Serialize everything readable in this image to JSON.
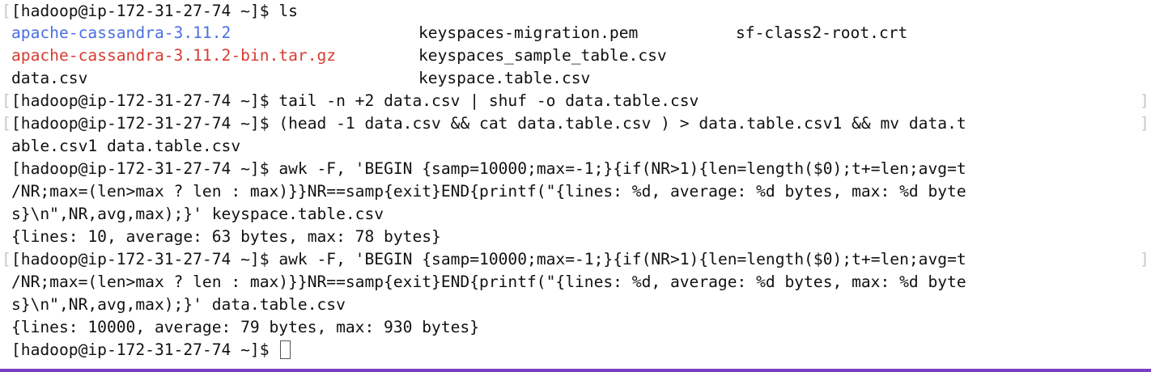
{
  "terminal": {
    "accent_color": "#7a3fbf",
    "prompt": "[hadoop@ip-172-31-27-74 ~]$",
    "ls": {
      "command": "ls",
      "files": {
        "col1": [
          {
            "name": "apache-cassandra-3.11.2",
            "kind": "directory",
            "color": "#4a6fe3"
          },
          {
            "name": "apache-cassandra-3.11.2-bin.tar.gz",
            "kind": "archive",
            "color": "#d63c31"
          },
          {
            "name": "data.csv",
            "kind": "file"
          }
        ],
        "col2": [
          {
            "name": "keyspaces-migration.pem"
          },
          {
            "name": "keyspaces_sample_table.csv"
          },
          {
            "name": "keyspace.table.csv"
          }
        ],
        "col3": [
          {
            "name": "sf-class2-root.crt"
          }
        ]
      }
    },
    "commands": {
      "tail": "tail -n +2 data.csv | shuf -o data.table.csv",
      "head_line1": "(head -1 data.csv && cat data.table.csv ) > data.table.csv1 && mv data.t",
      "head_line2": "able.csv1 data.table.csv",
      "awk1_line1": "awk -F, 'BEGIN {samp=10000;max=-1;}{if(NR>1){len=length($0);t+=len;avg=t",
      "awk1_line2": "/NR;max=(len>max ? len : max)}}NR==samp{exit}END{printf(\"{lines: %d, average: %d bytes, max: %d byte",
      "awk1_line3": "s}\\n\",NR,avg,max);}' keyspace.table.csv",
      "awk1_output": "{lines: 10, average: 63 bytes, max: 78 bytes}",
      "awk2_line1": "awk -F, 'BEGIN {samp=10000;max=-1;}{if(NR>1){len=length($0);t+=len;avg=t",
      "awk2_line2": "/NR;max=(len>max ? len : max)}}NR==samp{exit}END{printf(\"{lines: %d, average: %d bytes, max: %d byte",
      "awk2_line3": "s}\\n\",NR,avg,max);}' data.table.csv",
      "awk2_output": "{lines: 10000, average: 79 bytes, max: 930 bytes}"
    },
    "cursor_icon": "block-cursor-icon"
  }
}
